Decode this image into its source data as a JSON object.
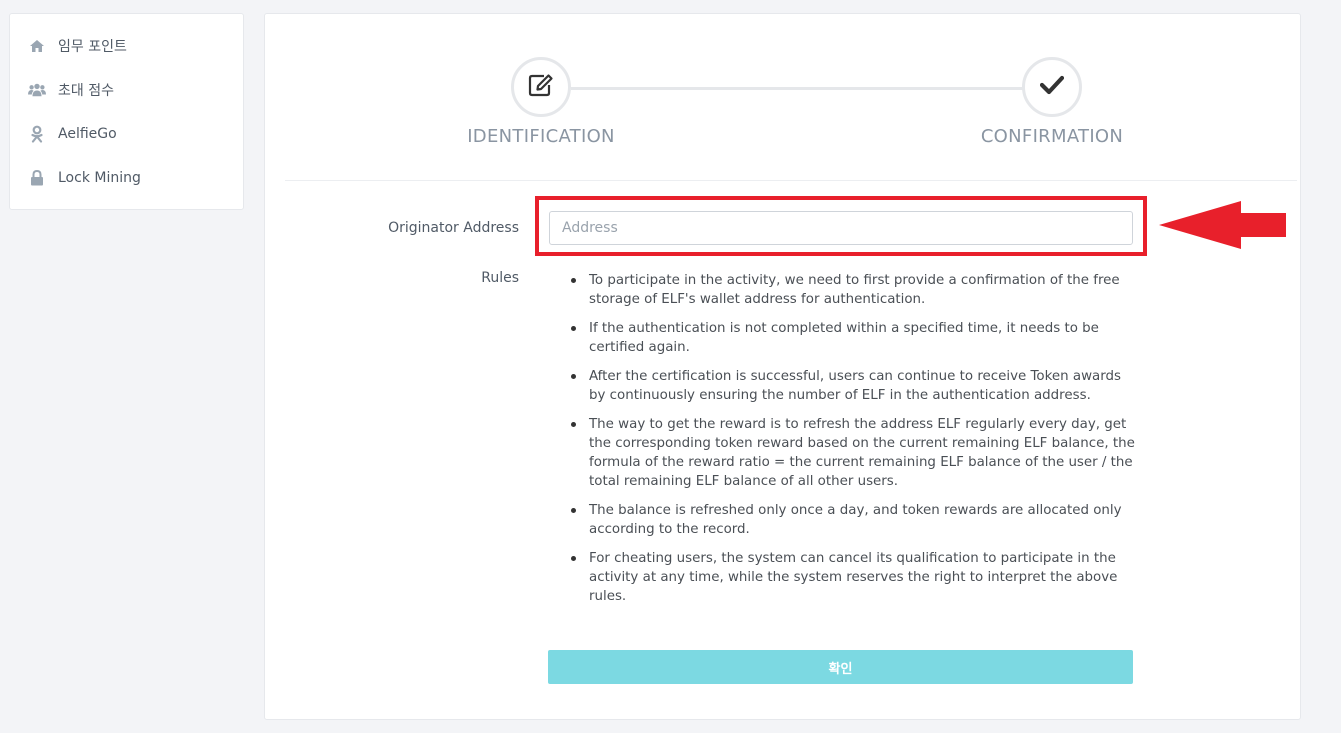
{
  "sidebar": {
    "items": [
      {
        "label": "임무 포인트",
        "icon": "home-icon"
      },
      {
        "label": "초대 점수",
        "icon": "users-icon"
      },
      {
        "label": "AelfieGo",
        "icon": "odnoklassniki-icon"
      },
      {
        "label": "Lock Mining",
        "icon": "lock-icon"
      }
    ]
  },
  "steps": [
    {
      "label": "IDENTIFICATION",
      "icon": "edit-icon"
    },
    {
      "label": "CONFIRMATION",
      "icon": "check-icon"
    }
  ],
  "form": {
    "address_label": "Originator Address",
    "address_placeholder": "Address",
    "address_value": "",
    "rules_label": "Rules",
    "rules": [
      "To participate in the activity, we need to first provide a confirmation of the free storage of ELF's wallet address for authentication.",
      "If the authentication is not completed within a specified time, it needs to be certified again.",
      "After the certification is successful, users can continue to receive Token awards by continuously ensuring the number of ELF in the authentication address.",
      "The way to get the reward is to refresh the address ELF regularly every day, get the corresponding token reward based on the current remaining ELF balance, the formula of the reward ratio = the current remaining ELF balance of the user / the total remaining ELF balance of all other users.",
      "The balance is refreshed only once a day, and token rewards are allocated only according to the record.",
      "For cheating users, the system can cancel its qualification to participate in the activity at any time, while the system reserves the right to interpret the above rules."
    ],
    "confirm_label": "확인"
  },
  "colors": {
    "highlight": "#e8202b",
    "button": "#7cd9e2",
    "sidebar_icon": "#9aa6b2"
  }
}
